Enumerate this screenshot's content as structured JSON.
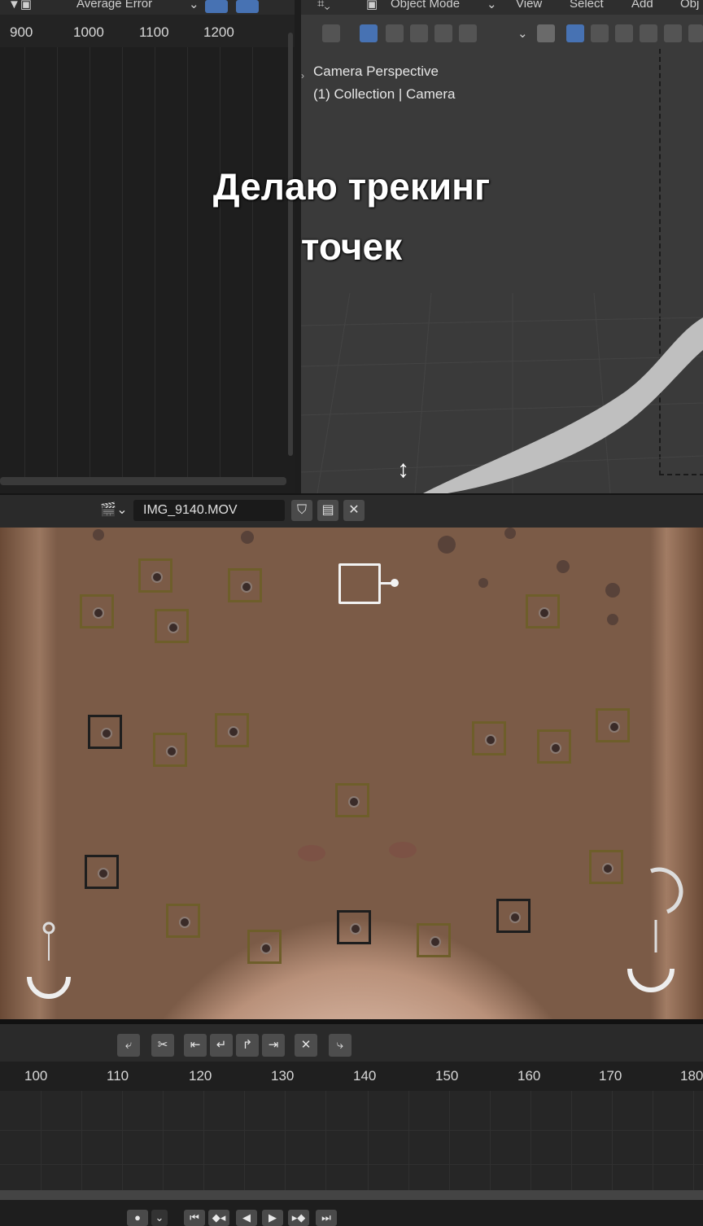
{
  "graph_editor": {
    "header_dropdown": "Average Error",
    "ruler_ticks": [
      "900",
      "1000",
      "1100",
      "1200"
    ]
  },
  "viewport": {
    "mode_dropdown": "Object Mode",
    "menus": [
      "View",
      "Select",
      "Add",
      "Obj"
    ],
    "overlay_line1": "Camera Perspective",
    "overlay_line2": "(1) Collection | Camera"
  },
  "caption": {
    "line1": "Делаю трекинг",
    "line2": "точек"
  },
  "clip_editor": {
    "clip_name": "IMG_9140.MOV"
  },
  "timeline": {
    "ticks": [
      "100",
      "110",
      "120",
      "130",
      "140",
      "150",
      "160",
      "170",
      "180"
    ]
  },
  "colors": {
    "accent": "#4772b3",
    "marker": "#6e5e2a",
    "active_track": "#f2f2f2"
  }
}
